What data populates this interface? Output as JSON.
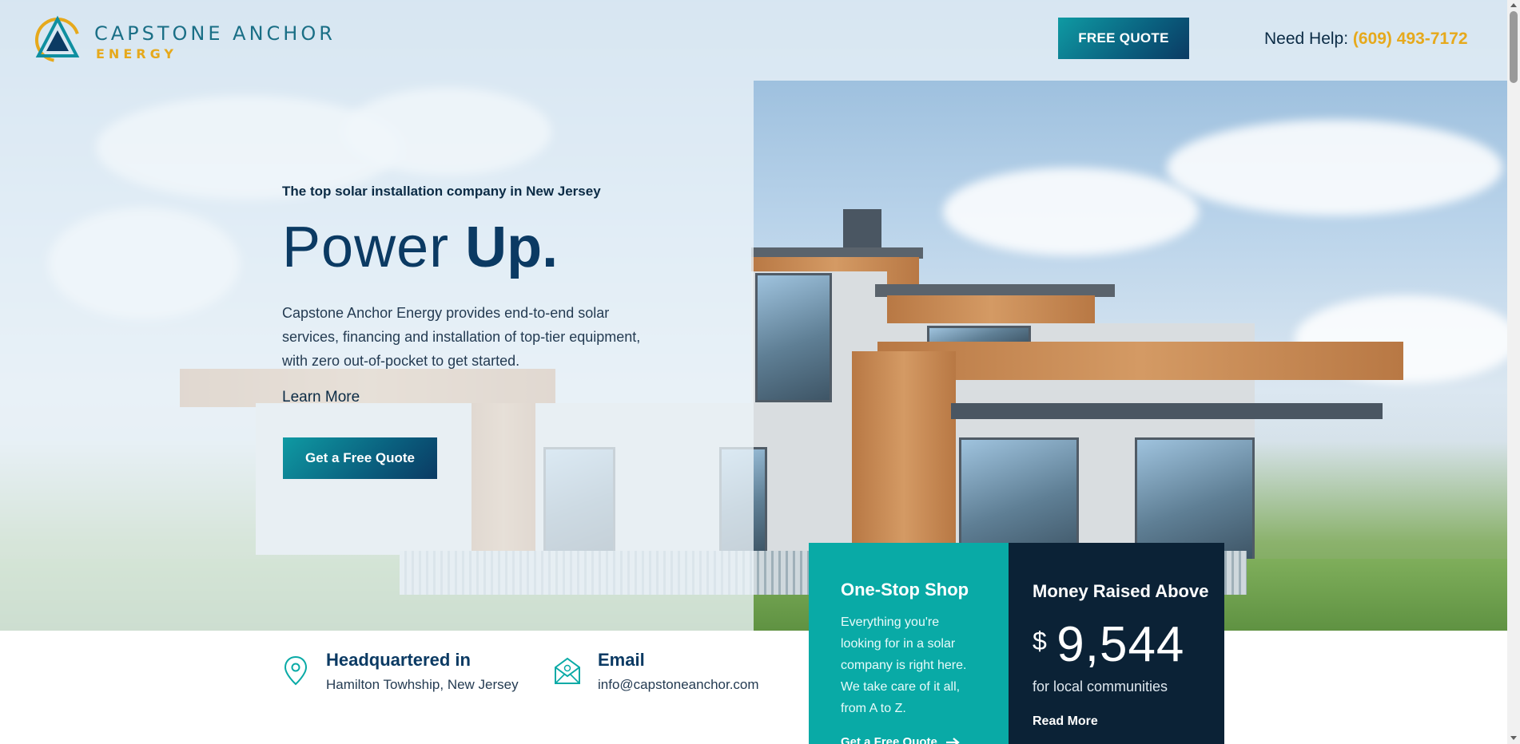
{
  "header": {
    "logo_name": "CAPSTONE ANCHOR",
    "logo_sub": "ENERGY",
    "cta_label": "FREE QUOTE",
    "help_label": "Need Help:",
    "phone": "(609) 493-7172"
  },
  "hero": {
    "eyebrow": "The top solar installation company in New Jersey",
    "headline_light": "Power",
    "headline_bold": "Up.",
    "lead": "Capstone Anchor Energy provides end-to-end solar services, financing and installation of top-tier equipment, with zero out-of-pocket to get started.",
    "learn_more": "Learn More",
    "cta_label": "Get a Free Quote"
  },
  "info": {
    "hq_title": "Headquartered in",
    "hq_value": "Hamilton Towhship, New Jersey",
    "email_title": "Email",
    "email_value": "info@capstoneanchor.com"
  },
  "cards": {
    "one_stop": {
      "title": "One-Stop Shop",
      "text": "Everything you're looking for in a solar company is right here. We take care of it all, from A to Z.",
      "link": "Get a Free Quote"
    },
    "money": {
      "title": "Money Raised Above",
      "currency": "$",
      "value": "9,544",
      "caption": "for local communities",
      "link": "Read More"
    }
  },
  "colors": {
    "teal": "#09aaa6",
    "navy": "#0b2236",
    "gold": "#e6a91c",
    "brand_blue": "#0b3a63"
  },
  "icons": [
    "logo-mark",
    "location-pin-icon",
    "email-icon",
    "arrow-right-icon"
  ]
}
